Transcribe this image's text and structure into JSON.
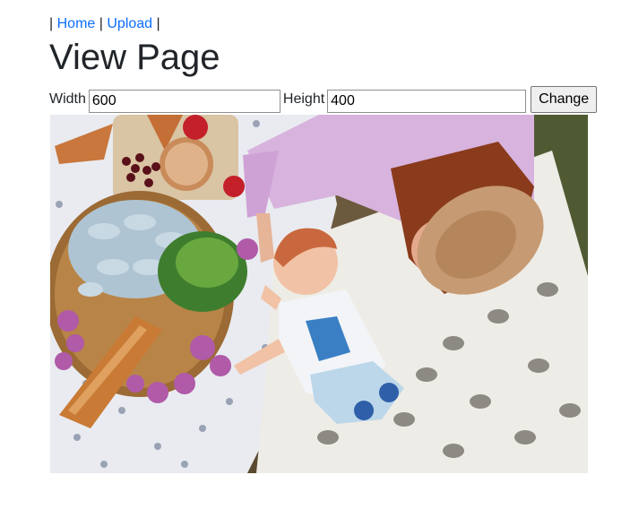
{
  "nav": {
    "separator": "|",
    "links": [
      {
        "label": "Home"
      },
      {
        "label": "Upload"
      }
    ]
  },
  "header": {
    "title": "View Page"
  },
  "resize_form": {
    "width_label": "Width",
    "width_value": "600",
    "height_label": "Height",
    "height_value": "400",
    "submit_label": "Change"
  },
  "image": {
    "alt": "Mother and baby lying on a picnic blanket with food basket"
  }
}
